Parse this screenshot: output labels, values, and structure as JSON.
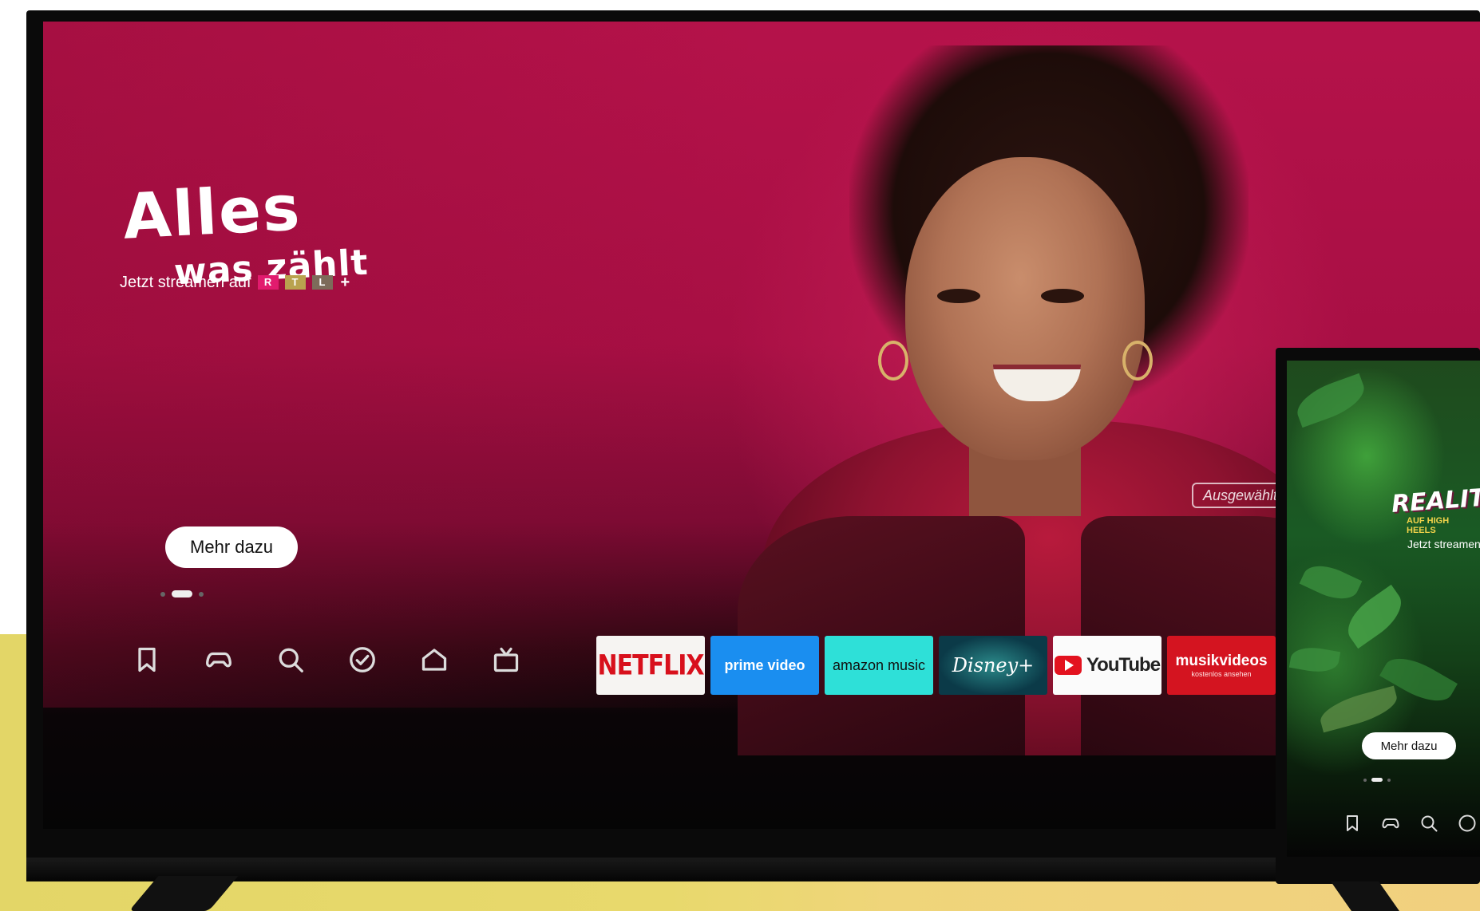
{
  "hero": {
    "title_line1": "Alles",
    "title_line2": "was zählt",
    "stream_text": "Jetzt streamen auf",
    "brand_letters": [
      "R",
      "T",
      "L"
    ],
    "brand_plus": "+",
    "cta_label": "Mehr dazu",
    "tag_label": "Ausgewählt",
    "carousel": {
      "count": 3,
      "active_index": 1
    }
  },
  "nav": {
    "icons": [
      "bookmark-icon",
      "gamepad-icon",
      "search-icon",
      "check-circle-icon",
      "home-icon",
      "live-tv-icon"
    ]
  },
  "apps": [
    {
      "id": "netflix",
      "label": "NETFLIX"
    },
    {
      "id": "prime",
      "label": "prime video"
    },
    {
      "id": "amazon",
      "label": "amazon music"
    },
    {
      "id": "disney",
      "label": "Disney+"
    },
    {
      "id": "youtube",
      "label": "YouTube"
    },
    {
      "id": "musik",
      "label": "musikvideos",
      "sub": "kostenlos ansehen"
    }
  ],
  "tv2": {
    "title": "REALITY",
    "subtitle": "AUF HIGH HEELS",
    "stream_text": "Jetzt streamen",
    "cta_label": "Mehr dazu"
  },
  "colors": {
    "hero_magenta": "#b5124a",
    "netflix_red": "#d8101c",
    "prime_blue": "#1a8ef0",
    "amazon_teal": "#2ee0d8",
    "youtube_red": "#e3121f",
    "musik_red": "#d41420",
    "rtl_r": "#e21b6e",
    "rtl_t": "#b9a24e",
    "rtl_l": "#7d6b5a"
  }
}
